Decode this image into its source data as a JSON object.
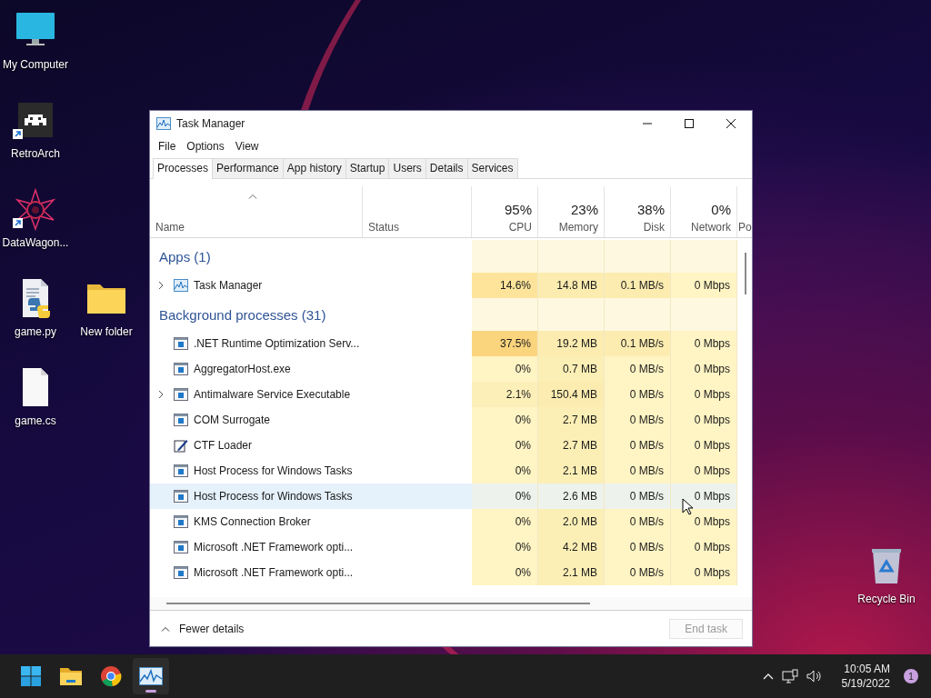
{
  "desktop_icons": [
    {
      "label": "My Computer",
      "kind": "monitor",
      "shortcut": false
    },
    {
      "label": "RetroArch",
      "kind": "invader",
      "shortcut": true
    },
    {
      "label": "DataWagon...",
      "kind": "star",
      "shortcut": true
    },
    {
      "label": "game.py",
      "kind": "python",
      "shortcut": false
    },
    {
      "label": "New folder",
      "kind": "folder",
      "shortcut": false
    },
    {
      "label": "game.cs",
      "kind": "file",
      "shortcut": false
    },
    {
      "label": "Recycle Bin",
      "kind": "bin"
    }
  ],
  "window": {
    "title": "Task Manager",
    "menu": [
      "File",
      "Options",
      "View"
    ],
    "tabs": [
      {
        "label": "Processes",
        "selected": true
      },
      {
        "label": "Performance",
        "selected": false
      },
      {
        "label": "App history",
        "selected": false
      },
      {
        "label": "Startup",
        "selected": false
      },
      {
        "label": "Users",
        "selected": false
      },
      {
        "label": "Details",
        "selected": false
      },
      {
        "label": "Services",
        "selected": false
      }
    ],
    "columns": [
      {
        "label": "Name",
        "sorted": true
      },
      {
        "label": "Status",
        "sorted": false
      },
      {
        "percent": "95%",
        "label": "CPU",
        "sorted": false
      },
      {
        "percent": "23%",
        "label": "Memory",
        "sorted": false
      },
      {
        "percent": "38%",
        "label": "Disk",
        "sorted": false
      },
      {
        "percent": "0%",
        "label": "Network",
        "sorted": false
      },
      {
        "label": "Po",
        "sorted": false
      }
    ],
    "groups": [
      {
        "title": "Apps (1)",
        "rows": [
          {
            "name": "Task Manager",
            "kind": "chart",
            "expandable": true,
            "selected": false,
            "cells": [
              {
                "text": "14.6%",
                "color": "#fde49a"
              },
              {
                "text": "14.8 MB",
                "color": "#fcecb0"
              },
              {
                "text": "0.1 MB/s",
                "color": "#fcecb0"
              },
              {
                "text": "0 Mbps",
                "color": "#fff4c4"
              }
            ]
          }
        ]
      },
      {
        "title": "Background processes (31)",
        "rows": [
          {
            "name": ".NET Runtime Optimization Serv...",
            "kind": "service",
            "expandable": false,
            "selected": false,
            "cells": [
              {
                "text": "37.5%",
                "color": "#fbd57e"
              },
              {
                "text": "19.2 MB",
                "color": "#fcecb0"
              },
              {
                "text": "0.1 MB/s",
                "color": "#fcecb0"
              },
              {
                "text": "0 Mbps",
                "color": "#fff4c4"
              }
            ]
          },
          {
            "name": "AggregatorHost.exe",
            "kind": "service",
            "expandable": false,
            "selected": false,
            "cells": [
              {
                "text": "0%",
                "color": "#fff4c4"
              },
              {
                "text": "0.7 MB",
                "color": "#fcefb6"
              },
              {
                "text": "0 MB/s",
                "color": "#fff4c4"
              },
              {
                "text": "0 Mbps",
                "color": "#fff4c4"
              }
            ]
          },
          {
            "name": "Antimalware Service Executable",
            "kind": "service",
            "expandable": true,
            "selected": false,
            "cells": [
              {
                "text": "2.1%",
                "color": "#fdefb8"
              },
              {
                "text": "150.4 MB",
                "color": "#fcecb0"
              },
              {
                "text": "0 MB/s",
                "color": "#fff4c4"
              },
              {
                "text": "0 Mbps",
                "color": "#fff4c4"
              }
            ]
          },
          {
            "name": "COM Surrogate",
            "kind": "service",
            "expandable": false,
            "selected": false,
            "cells": [
              {
                "text": "0%",
                "color": "#fff4c4"
              },
              {
                "text": "2.7 MB",
                "color": "#fcefb6"
              },
              {
                "text": "0 MB/s",
                "color": "#fff4c4"
              },
              {
                "text": "0 Mbps",
                "color": "#fff4c4"
              }
            ]
          },
          {
            "name": "CTF Loader",
            "kind": "pen",
            "expandable": false,
            "selected": false,
            "cells": [
              {
                "text": "0%",
                "color": "#fff4c4"
              },
              {
                "text": "2.7 MB",
                "color": "#fcefb6"
              },
              {
                "text": "0 MB/s",
                "color": "#fff4c4"
              },
              {
                "text": "0 Mbps",
                "color": "#fff4c4"
              }
            ]
          },
          {
            "name": "Host Process for Windows Tasks",
            "kind": "service",
            "expandable": false,
            "selected": false,
            "cells": [
              {
                "text": "0%",
                "color": "#fff4c4"
              },
              {
                "text": "2.1 MB",
                "color": "#fcefb6"
              },
              {
                "text": "0 MB/s",
                "color": "#fff4c4"
              },
              {
                "text": "0 Mbps",
                "color": "#fff4c4"
              }
            ]
          },
          {
            "name": "Host Process for Windows Tasks",
            "kind": "service",
            "expandable": false,
            "selected": true,
            "cells": [
              {
                "text": "0%",
                "color": "#eef2ec"
              },
              {
                "text": "2.6 MB",
                "color": "#eef2ec"
              },
              {
                "text": "0 MB/s",
                "color": "#eef2ec"
              },
              {
                "text": "0 Mbps",
                "color": "#eef2ec"
              }
            ]
          },
          {
            "name": "KMS Connection Broker",
            "kind": "service",
            "expandable": false,
            "selected": false,
            "cells": [
              {
                "text": "0%",
                "color": "#fff4c4"
              },
              {
                "text": "2.0 MB",
                "color": "#fcefb6"
              },
              {
                "text": "0 MB/s",
                "color": "#fff4c4"
              },
              {
                "text": "0 Mbps",
                "color": "#fff4c4"
              }
            ]
          },
          {
            "name": "Microsoft .NET Framework opti...",
            "kind": "service",
            "expandable": false,
            "selected": false,
            "cells": [
              {
                "text": "0%",
                "color": "#fff4c4"
              },
              {
                "text": "4.2 MB",
                "color": "#fcefb6"
              },
              {
                "text": "0 MB/s",
                "color": "#fff4c4"
              },
              {
                "text": "0 Mbps",
                "color": "#fff4c4"
              }
            ]
          },
          {
            "name": "Microsoft .NET Framework opti...",
            "kind": "service",
            "expandable": false,
            "selected": false,
            "cells": [
              {
                "text": "0%",
                "color": "#fff4c4"
              },
              {
                "text": "2.1 MB",
                "color": "#fcefb6"
              },
              {
                "text": "0 MB/s",
                "color": "#fff4c4"
              },
              {
                "text": "0 Mbps",
                "color": "#fff4c4"
              }
            ]
          }
        ]
      }
    ],
    "footer": {
      "toggle": "Fewer details",
      "end_task": {
        "label": "End task",
        "disabled": true
      }
    }
  },
  "taskbar": {
    "apps": [
      {
        "kind": "start",
        "selected": false
      },
      {
        "kind": "folder",
        "selected": false
      },
      {
        "kind": "browser",
        "selected": false
      },
      {
        "kind": "chart",
        "selected": true
      }
    ],
    "time": "10:05 AM",
    "date": "5/19/2022",
    "notifications": "1"
  }
}
